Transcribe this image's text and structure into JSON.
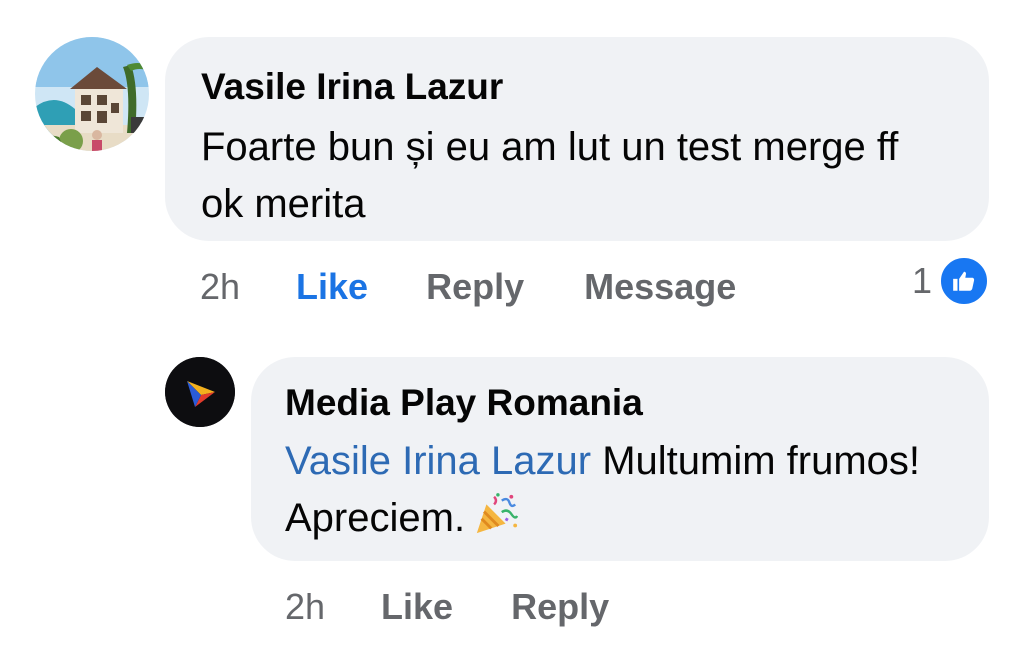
{
  "comments": [
    {
      "author": "Vasile Irina Lazur",
      "avatar_icon": "house-photo-avatar",
      "text": "Foarte bun și eu am lut un test merge ff ok merita",
      "time": "2h",
      "actions": {
        "like": "Like",
        "reply": "Reply",
        "message": "Message"
      },
      "reactions": {
        "count": "1",
        "type": "like-icon",
        "color": "#1877f2"
      }
    }
  ],
  "reply": {
    "author": "Media Play Romania",
    "avatar_icon": "media-play-logo-avatar",
    "mention": "Vasile Irina Lazur",
    "text": "Multumim frumos! Apreciem.",
    "emoji_icon": "party-popper-icon",
    "time": "2h",
    "actions": {
      "like": "Like",
      "reply": "Reply"
    }
  },
  "colors": {
    "bubble": "#f0f2f5",
    "like_active": "#1b74e4",
    "mention": "#2d6ab4",
    "secondary_text": "#65676b"
  }
}
